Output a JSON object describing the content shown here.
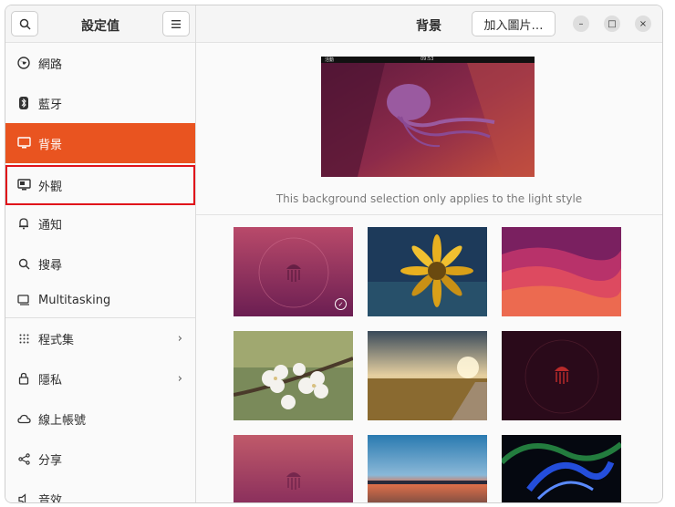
{
  "sidebar": {
    "title": "設定值",
    "search_icon": "search-icon",
    "menu_icon": "menu-icon",
    "items": [
      {
        "label": "網路",
        "icon": "globe-icon"
      },
      {
        "label": "藍牙",
        "icon": "bluetooth-icon"
      },
      {
        "label": "背景",
        "icon": "monitor-icon",
        "active": true
      },
      {
        "label": "外觀",
        "icon": "appearance-icon",
        "highlighted": true
      },
      {
        "label": "通知",
        "icon": "bell-icon"
      },
      {
        "label": "搜尋",
        "icon": "search-icon"
      },
      {
        "label": "Multitasking",
        "icon": "multitasking-icon"
      },
      {
        "label": "程式集",
        "icon": "apps-grid-icon",
        "chevron": "›"
      },
      {
        "label": "隱私",
        "icon": "lock-icon",
        "chevron": "›"
      },
      {
        "label": "線上帳號",
        "icon": "cloud-icon"
      },
      {
        "label": "分享",
        "icon": "share-icon"
      },
      {
        "label": "音效",
        "icon": "speaker-icon"
      }
    ]
  },
  "main": {
    "title": "背景",
    "add_button": "加入圖片…",
    "window_controls": {
      "minimize": "–",
      "maximize": "□",
      "close": "×"
    },
    "preview_topbar": {
      "left": "活動",
      "center": "09:53"
    },
    "note": "This background selection only applies to the light style",
    "accent": "#e95420"
  }
}
